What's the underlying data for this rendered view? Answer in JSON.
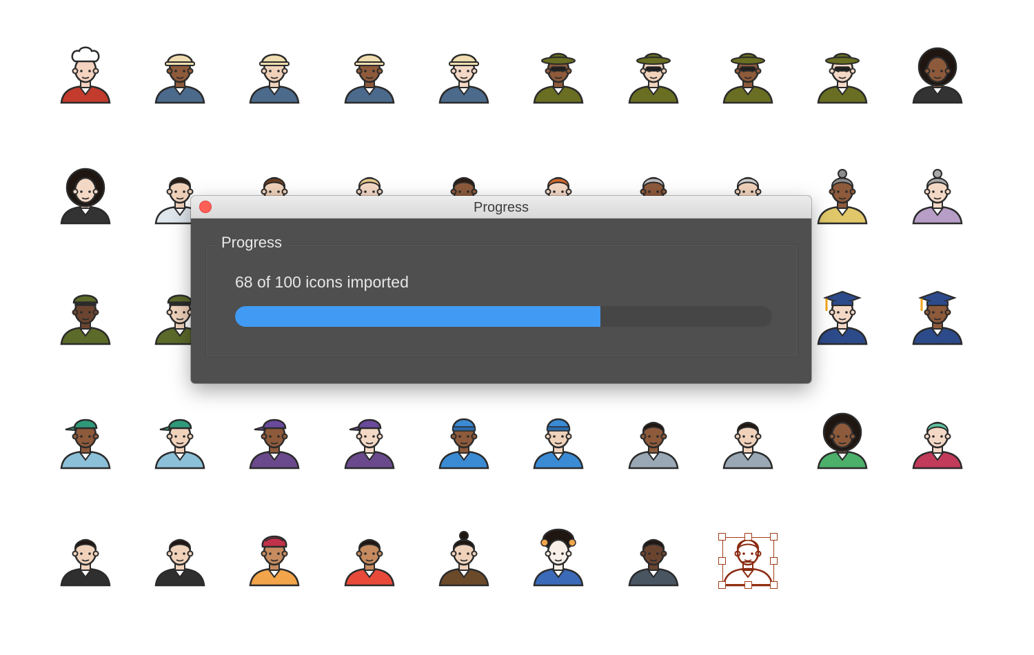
{
  "dialog": {
    "window_title": "Progress",
    "group_title": "Progress",
    "status_text": "68 of 100 icons imported",
    "progress": {
      "completed": 68,
      "total": 100,
      "fraction": 0.68,
      "fill_color": "#419bf5"
    }
  },
  "colors": {
    "background": "#ffffff",
    "dialog_body": "#4f4f4f",
    "close_button": "#fe5f57",
    "selection": "#a03a16"
  },
  "avatars": [
    {
      "name": "chef-woman-avatar",
      "skin": "#f4d3c0",
      "hair": "#3b2a22",
      "hat": "chef",
      "shirt": "#c23b2c"
    },
    {
      "name": "construction-worker-dark-avatar",
      "skin": "#8d5a3b",
      "hair": "#2d1c13",
      "hat": "hardhat",
      "shirt": "#4b6a8c"
    },
    {
      "name": "construction-worker-light-avatar",
      "skin": "#f0d2bb",
      "hair": "#7a5a3a",
      "hat": "hardhat",
      "shirt": "#4b6a8c"
    },
    {
      "name": "construction-worker-woman-dark-avatar",
      "skin": "#8d5a3b",
      "hair": "#2d1c13",
      "hat": "hardhat",
      "shirt": "#4b6a8c"
    },
    {
      "name": "construction-worker-woman-light-avatar",
      "skin": "#f4d8c6",
      "hair": "#2d1c13",
      "hat": "hardhat",
      "shirt": "#4b6a8c"
    },
    {
      "name": "detective-dark-avatar",
      "skin": "#8d5a3b",
      "hair": "#2d1c13",
      "hat": "fedora",
      "shirt": "#6a6e22"
    },
    {
      "name": "detective-light-avatar",
      "skin": "#f0d2bb",
      "hair": "#2d1c13",
      "hat": "fedora",
      "shirt": "#6a6e22"
    },
    {
      "name": "detective-woman-dark-avatar",
      "skin": "#8d5a3b",
      "hair": "#2d1c13",
      "hat": "fedora",
      "shirt": "#6a6e22"
    },
    {
      "name": "detective-woman-light-avatar",
      "skin": "#f4d8c6",
      "hair": "#2d1c13",
      "hat": "fedora",
      "shirt": "#6a6e22"
    },
    {
      "name": "afro-woman-dark-avatar",
      "skin": "#8d5a3b",
      "hair": "#1f1612",
      "hat": "afro",
      "shirt": "#333333"
    },
    {
      "name": "afro-woman-light-avatar",
      "skin": "#f4d8c6",
      "hair": "#1f1612",
      "hat": "afro",
      "shirt": "#333333"
    },
    {
      "name": "doctor-man-avatar",
      "skin": "#f0d2bb",
      "hair": "#2d1c13",
      "hat": "none",
      "shirt": "#dfe6ec"
    },
    {
      "name": "man-brown-hair-avatar",
      "skin": "#f0d2bb",
      "hair": "#6b3f22",
      "hat": "none",
      "shirt": "#4a4a4a"
    },
    {
      "name": "woman-blonde-avatar",
      "skin": "#f4d8c6",
      "hair": "#e6c98a",
      "hat": "none",
      "shirt": "#4a4a4a"
    },
    {
      "name": "woman-dark-curly-avatar",
      "skin": "#8d5a3b",
      "hair": "#2d1c13",
      "hat": "none",
      "shirt": "#4a4a4a"
    },
    {
      "name": "woman-red-hair-avatar",
      "skin": "#f4d8c6",
      "hair": "#d06a2c",
      "hat": "none",
      "shirt": "#4a4a4a"
    },
    {
      "name": "old-man-dark-avatar",
      "skin": "#8d5a3b",
      "hair": "#bbbbbb",
      "hat": "none",
      "shirt": "#4a4a4a"
    },
    {
      "name": "old-man-light-avatar",
      "skin": "#f0d2bb",
      "hair": "#cccccc",
      "hat": "none",
      "shirt": "#4a4a4a"
    },
    {
      "name": "grandma-dark-avatar",
      "skin": "#8d5a3b",
      "hair": "#8c8c8c",
      "hat": "bun",
      "shirt": "#e0c76a"
    },
    {
      "name": "grandma-light-avatar",
      "skin": "#f4d8c6",
      "hair": "#a8a8a8",
      "hat": "bun",
      "shirt": "#b79ec6"
    },
    {
      "name": "military-officer-dark-avatar",
      "skin": "#6b4430",
      "hair": "#1f1612",
      "hat": "cap-military",
      "shirt": "#5c6a2a"
    },
    {
      "name": "military-officer-light-avatar",
      "skin": "#f0d2bb",
      "hair": "#1f1612",
      "hat": "cap-military",
      "shirt": "#5c6a2a"
    },
    {
      "name": "graduate-woman-light-avatar",
      "skin": "#f4d8c6",
      "hair": "#1f1612",
      "hat": "graduate",
      "shirt": "#2d4a8a"
    },
    {
      "name": "graduate-woman-dark-avatar",
      "skin": "#8d5a3b",
      "hair": "#1f1612",
      "hat": "graduate",
      "shirt": "#2d4a8a"
    },
    {
      "name": "hipster-cap-dark-avatar",
      "skin": "#8d5a3b",
      "hair": "#1f1612",
      "hat": "cap-green",
      "shirt": "#8cc0d8"
    },
    {
      "name": "hipster-cap-light-avatar",
      "skin": "#f0d2bb",
      "hair": "#1f1612",
      "hat": "cap-green",
      "shirt": "#8cc0d8"
    },
    {
      "name": "purple-cap-woman-dark-avatar",
      "skin": "#8d5a3b",
      "hair": "#1f1612",
      "hat": "cap-purple",
      "shirt": "#6a4a8c"
    },
    {
      "name": "purple-cap-woman-light-avatar",
      "skin": "#f4d8c6",
      "hair": "#1f1612",
      "hat": "cap-purple",
      "shirt": "#6a4a8c"
    },
    {
      "name": "beanie-man-dark-avatar",
      "skin": "#8d5a3b",
      "hair": "#1f1612",
      "hat": "beanie",
      "shirt": "#3b8bd4"
    },
    {
      "name": "beanie-man-light-avatar",
      "skin": "#f0d2bb",
      "hair": "#1f1612",
      "hat": "beanie",
      "shirt": "#3b8bd4"
    },
    {
      "name": "bearded-man-dark-avatar",
      "skin": "#8d5a3b",
      "hair": "#1f1612",
      "hat": "none",
      "shirt": "#9aa8b6"
    },
    {
      "name": "bearded-man-light-avatar",
      "skin": "#f0d2bb",
      "hair": "#1f1612",
      "hat": "none",
      "shirt": "#9aa8b6"
    },
    {
      "name": "afro-man-scarf-avatar",
      "skin": "#8d5a3b",
      "hair": "#1f1612",
      "hat": "afro",
      "shirt": "#4caf6a"
    },
    {
      "name": "green-hair-woman-avatar",
      "skin": "#f4d8c6",
      "hair": "#5fc4a2",
      "hat": "none",
      "shirt": "#c23b5a"
    },
    {
      "name": "hipster-man-dark-hair-avatar",
      "skin": "#f0d2bb",
      "hair": "#1f1612",
      "hat": "none",
      "shirt": "#2f2f2f"
    },
    {
      "name": "hipster-man-beard-avatar",
      "skin": "#f0d2bb",
      "hair": "#1f1612",
      "hat": "none",
      "shirt": "#2f2f2f"
    },
    {
      "name": "sikh-man-avatar",
      "skin": "#c68b5f",
      "hair": "#1f1612",
      "hat": "turban",
      "shirt": "#f2a54a"
    },
    {
      "name": "indian-woman-avatar",
      "skin": "#c68b5f",
      "hair": "#1f1612",
      "hat": "none",
      "shirt": "#e84a3a"
    },
    {
      "name": "samurai-man-avatar",
      "skin": "#f0d2bb",
      "hair": "#1f1612",
      "hat": "bun",
      "shirt": "#6b4a2a"
    },
    {
      "name": "geisha-woman-avatar",
      "skin": "#f7efe8",
      "hair": "#1f1612",
      "hat": "geisha",
      "shirt": "#3b6ab8"
    },
    {
      "name": "man-glasses-dark-avatar",
      "skin": "#6b4430",
      "hair": "#1f1612",
      "hat": "none",
      "shirt": "#4a5562"
    },
    {
      "name": "selected-man-avatar",
      "skin": "#c97a5a",
      "hair": "#8a2a10",
      "hat": "none",
      "shirt": "#8a2a10"
    }
  ]
}
